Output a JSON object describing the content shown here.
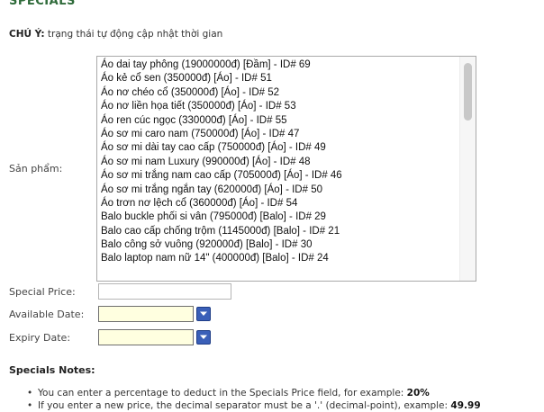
{
  "page": {
    "heading": "SPECIALS",
    "note_label": "CHÚ Ý:",
    "note_text": "trạng thái tự động cập nhật thời gian"
  },
  "form": {
    "product_label": "Sản phẩm:",
    "products": [
      "Áo dai tay phông (19000000đ) [Đầm] - ID# 69",
      "Áo kẻ cổ sen (350000đ) [Áo] - ID# 51",
      "Áo nơ chéo cổ (350000đ) [Áo] - ID# 52",
      "Áo nơ liền họa tiết (350000đ) [Áo] - ID# 53",
      "Áo ren cúc ngọc (330000đ) [Áo] - ID# 55",
      "Áo sơ mi caro nam (750000đ) [Áo] - ID# 47",
      "Áo sơ mi dài tay cao cấp (750000đ) [Áo] - ID# 49",
      "Áo sơ mi nam Luxury (990000đ) [Áo] - ID# 48",
      "Áo sơ mi trắng nam cao cấp (705000đ) [Áo] - ID# 46",
      "Áo sơ mi trắng ngắn tay (620000đ) [Áo] - ID# 50",
      "Áo trơn nơ lệch cổ (360000đ) [Áo] - ID# 54",
      "Balo buckle phối si vân (795000đ) [Balo] - ID# 29",
      "Balo cao cấp chống trộm (1145000đ) [Balo] - ID# 21",
      "Balo công sở vuông (920000đ) [Balo] - ID# 30",
      "Balo laptop nam nữ 14\" (400000đ) [Balo] - ID# 24"
    ],
    "special_price_label": "Special Price:",
    "special_price_value": "",
    "available_date_label": "Available Date:",
    "available_date_value": "",
    "expiry_date_label": "Expiry Date:",
    "expiry_date_value": ""
  },
  "notes": {
    "title": "Specials Notes:",
    "item1_text": "You can enter a percentage to deduct in the Specials Price field, for example: ",
    "item1_bold": "20%",
    "item2_text": "If you enter a new price, the decimal separator must be a '.' (decimal-point), example: ",
    "item2_bold": "49.99"
  },
  "colors": {
    "heading": "#2f6b3a",
    "date_field_bg": "#ffffe0",
    "calendar_button": "#3a5fb8"
  },
  "icons": {
    "calendar_button": "chevron-down-icon"
  }
}
